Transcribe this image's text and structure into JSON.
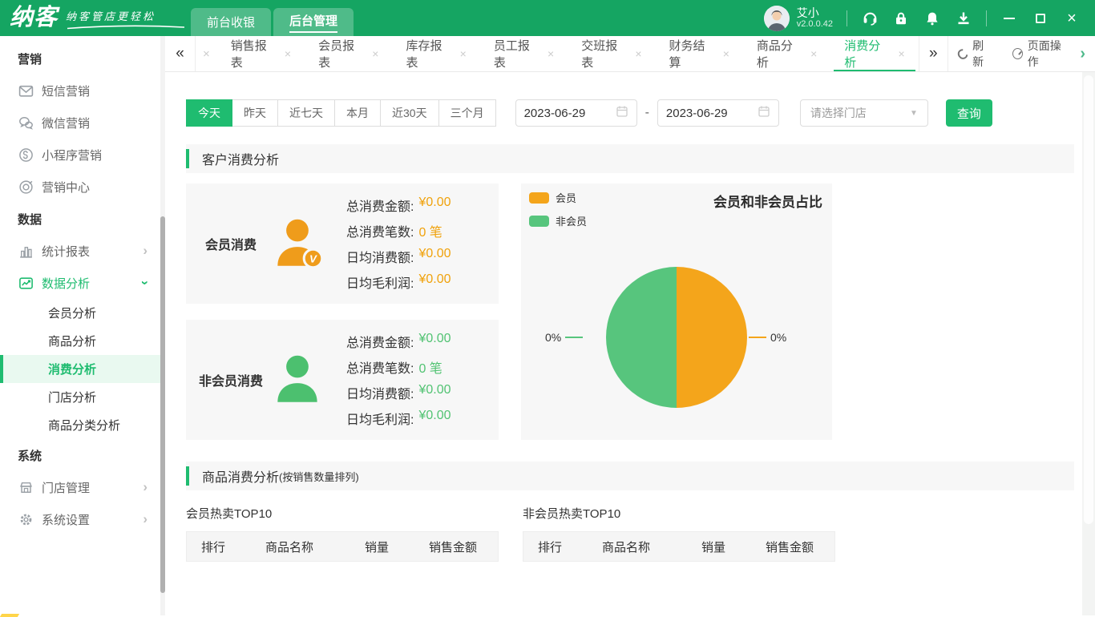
{
  "topbar": {
    "logo": "纳客",
    "slogan": "纳客管店更轻松",
    "nav": [
      {
        "label": "前台收银",
        "active": false
      },
      {
        "label": "后台管理",
        "active": true
      }
    ],
    "user": {
      "name": "艾小",
      "version": "v2.0.0.42"
    },
    "icons": [
      "service-icon",
      "lock-icon",
      "bell-icon",
      "download-icon"
    ],
    "window": {
      "close_glyph": "×"
    },
    "colors": {
      "topbar_green": "#15a562",
      "accent_green": "#1fbc70"
    }
  },
  "sidebar": {
    "chevron_glyph": "›",
    "sections": [
      {
        "header": "营销",
        "items": [
          {
            "label": "短信营销",
            "icon": "mail-icon"
          },
          {
            "label": "微信营销",
            "icon": "wechat-icon"
          },
          {
            "label": "小程序营销",
            "icon": "miniprogram-icon"
          },
          {
            "label": "营销中心",
            "icon": "target-icon"
          }
        ]
      },
      {
        "header": "数据",
        "items": [
          {
            "label": "统计报表",
            "icon": "bar-chart-icon",
            "state": "collapsed"
          },
          {
            "label": "数据分析",
            "icon": "line-chart-icon",
            "state": "expanded",
            "active": true,
            "children": [
              {
                "label": "会员分析"
              },
              {
                "label": "商品分析"
              },
              {
                "label": "消费分析",
                "selected": true
              },
              {
                "label": "门店分析"
              },
              {
                "label": "商品分类分析"
              }
            ]
          }
        ]
      },
      {
        "header": "系统",
        "items": [
          {
            "label": "门店管理",
            "icon": "store-icon",
            "state": "collapsed"
          },
          {
            "label": "系统设置",
            "icon": "gear-icon",
            "state": "collapsed"
          }
        ]
      }
    ]
  },
  "tabbar": {
    "scroll_left": "«",
    "scroll_right": "»",
    "close_glyph": "×",
    "tabs": [
      {
        "label": "销售报表"
      },
      {
        "label": "会员报表"
      },
      {
        "label": "库存报表"
      },
      {
        "label": "员工报表"
      },
      {
        "label": "交班报表"
      },
      {
        "label": "财务结算"
      },
      {
        "label": "商品分析"
      },
      {
        "label": "消费分析",
        "active": true
      }
    ],
    "actions": {
      "refresh": "刷新",
      "page_ops": "页面操作",
      "more_glyph": "›"
    }
  },
  "filters": {
    "quick": [
      {
        "label": "今天",
        "active": true
      },
      {
        "label": "昨天"
      },
      {
        "label": "近七天"
      },
      {
        "label": "本月"
      },
      {
        "label": "近30天"
      },
      {
        "label": "三个月"
      }
    ],
    "date_from": "2023-06-29",
    "range_separator": "-",
    "date_to": "2023-06-29",
    "store_placeholder": "请选择门店",
    "caret_glyph": "▼",
    "search_label": "查询"
  },
  "sections": {
    "customer_title": "客户消费分析",
    "product_title": "商品消费分析",
    "product_note": "(按销售数量排列)"
  },
  "cards": [
    {
      "title": "会员消费",
      "icon": "member-user-icon",
      "value_color": "#f0a20c",
      "rows": [
        {
          "label": "总消费金额:",
          "value": "¥0.00"
        },
        {
          "label": "总消费笔数:",
          "value": "0 笔"
        },
        {
          "label": "日均消费额:",
          "value": "¥0.00"
        },
        {
          "label": "日均毛利润:",
          "value": "¥0.00"
        }
      ]
    },
    {
      "title": "非会员消费",
      "icon": "nonmember-user-icon",
      "value_color": "#52c373",
      "rows": [
        {
          "label": "总消费金额:",
          "value": "¥0.00"
        },
        {
          "label": "总消费笔数:",
          "value": "0 笔"
        },
        {
          "label": "日均消费额:",
          "value": "¥0.00"
        },
        {
          "label": "日均毛利润:",
          "value": "¥0.00"
        }
      ]
    }
  ],
  "chart_data": {
    "type": "pie",
    "title": "会员和非会员占比",
    "legend_position": "top-left",
    "slices": [
      {
        "label": "会员",
        "pct_label": "0%",
        "display_fraction": 0.5,
        "color": "#f4a51b"
      },
      {
        "label": "非会员",
        "pct_label": "0%",
        "display_fraction": 0.5,
        "color": "#57c57d"
      }
    ]
  },
  "tables": {
    "headers": [
      "排行",
      "商品名称",
      "销量",
      "销售金额"
    ],
    "member": {
      "title": "会员热卖TOP10",
      "rows": []
    },
    "nonmember": {
      "title": "非会员热卖TOP10",
      "rows": []
    }
  }
}
